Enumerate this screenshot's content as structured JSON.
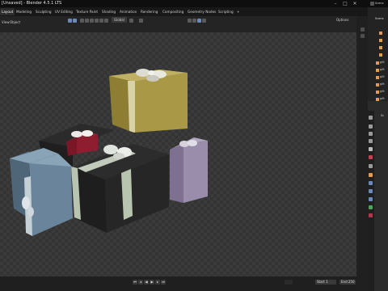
{
  "window": {
    "title": "[Unsaved] - Blender 4.5.1 LTS",
    "controls": [
      "–",
      "□",
      "✕"
    ]
  },
  "workspace_tabs": [
    {
      "label": "Layout",
      "active": true
    },
    {
      "label": "Modeling"
    },
    {
      "label": "Sculpting"
    },
    {
      "label": "UV Editing"
    },
    {
      "label": "Texture Paint"
    },
    {
      "label": "Shading"
    },
    {
      "label": "Animation"
    },
    {
      "label": "Rendering"
    },
    {
      "label": "Compositing"
    },
    {
      "label": "Geometry Nodes"
    },
    {
      "label": "Scripting"
    },
    {
      "label": "+"
    }
  ],
  "viewport_header": {
    "view_label": "View",
    "object_label": "Object",
    "transform_orientation": "Global",
    "options_label": "Options"
  },
  "timeline": {
    "start_label": "Start",
    "start_value": "1",
    "end_label": "End",
    "end_value": "250"
  },
  "outliner": {
    "scene_label": "Scene",
    "collection_label": "Scene",
    "items": [
      "gift",
      "gift",
      "gift",
      "gift",
      "gift",
      "gift",
      "gift",
      "gift"
    ]
  },
  "properties": {
    "scene_label": "Sc"
  },
  "colors": {
    "accent": "#4772b3",
    "active_tab": "#2d2d2d",
    "object_orange": "#e59a4d"
  }
}
